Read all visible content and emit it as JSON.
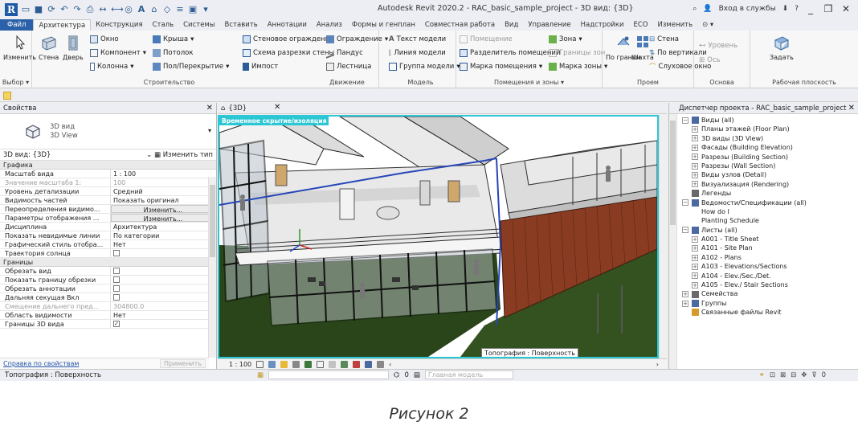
{
  "titlebar": {
    "logo": "R",
    "title": "Autodesk Revit 2020.2 - RAC_basic_sample_project - 3D вид: {3D}",
    "signin": "Вход в службы",
    "help": "?",
    "min": "_",
    "restore": "❐",
    "close": "✕"
  },
  "tabs": [
    "Файл",
    "Архитектура",
    "Конструкция",
    "Сталь",
    "Системы",
    "Вставить",
    "Аннотации",
    "Анализ",
    "Формы и генплан",
    "Совместная работа",
    "Вид",
    "Управление",
    "Надстройки",
    "ECO",
    "Изменить"
  ],
  "ribbon": {
    "select": {
      "modify": "Изменить",
      "title": "Выбор ▾"
    },
    "build": {
      "title": "Строительство",
      "wall": "Стена",
      "door": "Дверь",
      "window": "Окно",
      "component": "Компонент",
      "column": "Колонна",
      "roof": "Крыша",
      "ceiling": "Потолок",
      "floor": "Пол/Перекрытие",
      "curtain_system": "Стеновое ограждение",
      "curtain_grid": "Схема разрезки стены",
      "mullion": "Импост"
    },
    "circulation": {
      "title": "Движение",
      "railing": "Ограждение",
      "ramp": "Пандус",
      "stair": "Лестница"
    },
    "model": {
      "title": "Модель",
      "model_text": "Текст модели",
      "model_line": "Линия модели",
      "model_group": "Группа модели"
    },
    "room": {
      "title": "Помещения и зоны ▾",
      "room": "Помещение",
      "separator": "Разделитель помещений",
      "tag_room": "Марка помещения",
      "area": "Зона",
      "area_boundary": "Границы зон",
      "tag_area": "Марка зоны"
    },
    "opening": {
      "title": "Проем",
      "by_face": "По граням",
      "shaft": "Шахта",
      "wall": "Стена",
      "vertical": "По вертикали",
      "dormer": "Слуховое окно"
    },
    "datum": {
      "title": "Основа",
      "level": "Уровень",
      "grid": "Ось"
    },
    "workplane": {
      "title": "Рабочая плоскость",
      "set": "Задать"
    }
  },
  "properties": {
    "header": "Свойства",
    "type_name": "3D вид",
    "type_sub": "3D View",
    "instance": "3D вид: {3D}",
    "edit_type": "Изменить тип",
    "sections": [
      {
        "name": "Графика",
        "rows": [
          {
            "name": "Масштаб вида",
            "value": "1 : 100",
            "kind": "text"
          },
          {
            "name": "Значение масштаба 1:",
            "value": "100",
            "kind": "dim"
          },
          {
            "name": "Уровень детализации",
            "value": "Средний",
            "kind": "text"
          },
          {
            "name": "Видимость частей",
            "value": "Показать оригинал",
            "kind": "text"
          },
          {
            "name": "Переопределения видимо...",
            "value": "Изменить...",
            "kind": "button"
          },
          {
            "name": "Параметры отображения ...",
            "value": "Изменить...",
            "kind": "button"
          },
          {
            "name": "Дисциплина",
            "value": "Архитектура",
            "kind": "text"
          },
          {
            "name": "Показать невидимые линии",
            "value": "По категории",
            "kind": "text"
          },
          {
            "name": "Графический стиль отобра...",
            "value": "Нет",
            "kind": "text"
          },
          {
            "name": "Траектория солнца",
            "value": "",
            "kind": "checkbox"
          }
        ]
      },
      {
        "name": "Границы",
        "rows": [
          {
            "name": "Обрезать вид",
            "value": "",
            "kind": "checkbox"
          },
          {
            "name": "Показать границу обрезки",
            "value": "",
            "kind": "checkbox"
          },
          {
            "name": "Обрезать аннотации",
            "value": "",
            "kind": "checkbox"
          },
          {
            "name": "Дальняя секущая Вкл",
            "value": "",
            "kind": "checkbox"
          },
          {
            "name": "Смещение дальнего пред...",
            "value": "304800.0",
            "kind": "dim"
          },
          {
            "name": "Область видимости",
            "value": "Нет",
            "kind": "text"
          },
          {
            "name": "Границы 3D вида",
            "value": "✓",
            "kind": "checkbox"
          }
        ]
      }
    ],
    "help_link": "Справка по свойствам",
    "apply": "Применить"
  },
  "view": {
    "tab": "{3D}",
    "temp_hide": "Временное скрытие/изоляция",
    "tooltip": "Топография : Поверхность",
    "scale": "1 : 100"
  },
  "browser": {
    "header": "Диспетчер проекта - RAC_basic_sample_project",
    "items": [
      {
        "label": "Виды (all)",
        "level": 0,
        "exp": "−",
        "icon": "views"
      },
      {
        "label": "Планы этажей (Floor Plan)",
        "level": 1,
        "exp": "+"
      },
      {
        "label": "3D виды (3D View)",
        "level": 1,
        "exp": "+"
      },
      {
        "label": "Фасады (Building Elevation)",
        "level": 1,
        "exp": "+"
      },
      {
        "label": "Разрезы (Building Section)",
        "level": 1,
        "exp": "+"
      },
      {
        "label": "Разрезы (Wall Section)",
        "level": 1,
        "exp": "+"
      },
      {
        "label": "Виды узлов (Detail)",
        "level": 1,
        "exp": "+"
      },
      {
        "label": "Визуализация (Rendering)",
        "level": 1,
        "exp": "+"
      },
      {
        "label": "Легенды",
        "level": 0,
        "exp": "",
        "icon": "legend"
      },
      {
        "label": "Ведомости/Спецификации (all)",
        "level": 0,
        "exp": "−",
        "icon": "schedule"
      },
      {
        "label": "How do I",
        "level": 2,
        "exp": ""
      },
      {
        "label": "Planting Schedule",
        "level": 2,
        "exp": ""
      },
      {
        "label": "Листы (all)",
        "level": 0,
        "exp": "−",
        "icon": "sheet"
      },
      {
        "label": "A001 - Title Sheet",
        "level": 1,
        "exp": "+"
      },
      {
        "label": "A101 - Site Plan",
        "level": 1,
        "exp": "+"
      },
      {
        "label": "A102 - Plans",
        "level": 1,
        "exp": "+"
      },
      {
        "label": "A103 - Elevations/Sections",
        "level": 1,
        "exp": "+"
      },
      {
        "label": "A104 - Elev./Sec./Det.",
        "level": 1,
        "exp": "+"
      },
      {
        "label": "A105 - Elev./ Stair Sections",
        "level": 1,
        "exp": "+"
      },
      {
        "label": "Семейства",
        "level": 0,
        "exp": "+",
        "icon": "family"
      },
      {
        "label": "Группы",
        "level": 0,
        "exp": "+",
        "icon": "group"
      },
      {
        "label": "Связанные файлы Revit",
        "level": 0,
        "exp": "",
        "icon": "link"
      }
    ]
  },
  "status": {
    "text": "Топография : Поверхность",
    "zero": "0",
    "model": "Главная модель",
    "filter": "0"
  },
  "caption": "Рисунок 2",
  "colors": {
    "accent": "#2b61a8",
    "viewport_border": "#2bc7d4",
    "brick": "#8a3c22",
    "grass": "#2d4a1a"
  }
}
